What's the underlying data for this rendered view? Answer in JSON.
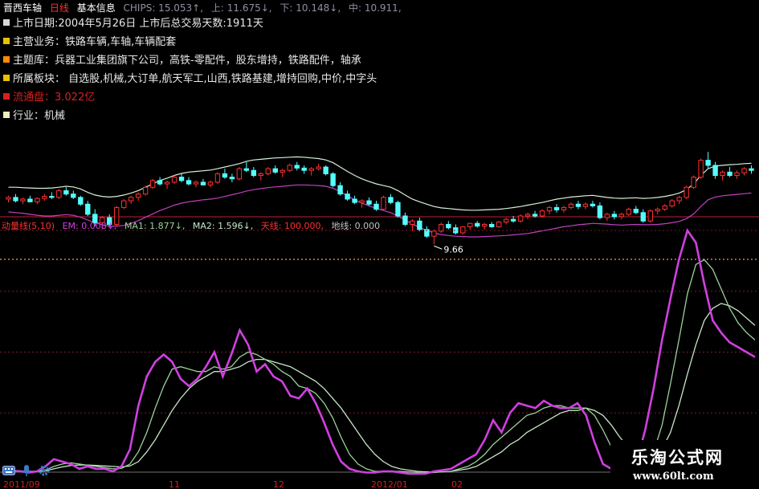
{
  "header": {
    "stock_name": "晋西车轴",
    "period": "日线",
    "info_title": "基本信息",
    "chips": "CHIPS: 15.053↑,",
    "up": "上: 11.675↓,",
    "down": "下: 10.148↓,",
    "mid": "中: 10.911,"
  },
  "info_lines": [
    {
      "text": "上市日期:2004年5月26日  上市后总交易天数:1911天",
      "color": "#e8e8e8",
      "sq": "#d8d8d8"
    },
    {
      "text": "主营业务：铁路车辆,车轴,车辆配套",
      "color": "#e8e8e8",
      "sq": "#e6c200"
    },
    {
      "text": "主题库：兵器工业集团旗下公司，高铁-零配件，股东增持，铁路配件，轴承",
      "color": "#e8e8e8",
      "sq": "#ff8c00"
    },
    {
      "text": "所属板块：  自选股,机械,大订单,航天军工,山西,铁路基建,增持回购,中价,中字头",
      "color": "#e8e8e8",
      "sq": "#e6c200"
    },
    {
      "text": "流通盘：3.022亿",
      "color": "#d82020",
      "sq": "#d82020"
    },
    {
      "text": "行业：机械",
      "color": "#e8e8e8",
      "sq": "#f0f0c0"
    }
  ],
  "indicator_header": {
    "name": "动量线(5,10)",
    "em": "EM: 0.008↓,",
    "ma1": "MA1: 1.877↓,",
    "ma2": "MA2: 1.596↓,",
    "tj": "天线: 100.000,",
    "dj": "地线: 0.000"
  },
  "low_marker": "9.66",
  "watermark": {
    "title": "乐淘公式网",
    "url": "www.60lt.com"
  },
  "date_labels": [
    "2011/09",
    "11",
    "12",
    "2012/01",
    "02"
  ],
  "toolbar_icons": [
    "keyboard-icon",
    "microphone-icon",
    "gear-icon"
  ],
  "colors": {
    "up": "#ff3030",
    "down": "#54ffff",
    "band_upper": "#d8f0d8",
    "band_lower": "#c040c0",
    "em": "#d040e0",
    "ma1": "#9bd39b",
    "ma2": "#c8e6c8",
    "grid": "#7a1a2a"
  },
  "chart_data": [
    {
      "type": "candlestick",
      "title": "晋西车轴 日线",
      "ylim": [
        9.0,
        13.5
      ],
      "low_label": 9.66,
      "candles": [
        [
          11.0,
          11.1,
          10.9,
          11.05
        ],
        [
          11.05,
          11.15,
          10.9,
          10.95
        ],
        [
          10.95,
          11.05,
          10.85,
          11.0
        ],
        [
          11.0,
          11.1,
          10.9,
          10.92
        ],
        [
          10.92,
          11.05,
          10.85,
          11.02
        ],
        [
          11.02,
          11.15,
          10.95,
          11.08
        ],
        [
          11.08,
          11.2,
          11.0,
          11.05
        ],
        [
          11.05,
          11.3,
          11.0,
          11.25
        ],
        [
          11.25,
          11.35,
          11.1,
          11.15
        ],
        [
          11.15,
          11.25,
          11.0,
          11.05
        ],
        [
          11.05,
          11.1,
          10.8,
          10.85
        ],
        [
          10.85,
          10.95,
          10.5,
          10.55
        ],
        [
          10.55,
          10.7,
          10.2,
          10.3
        ],
        [
          10.3,
          10.5,
          10.1,
          10.45
        ],
        [
          10.45,
          10.55,
          10.2,
          10.25
        ],
        [
          10.25,
          10.8,
          10.2,
          10.75
        ],
        [
          10.75,
          11.0,
          10.7,
          10.95
        ],
        [
          10.95,
          11.1,
          10.85,
          11.05
        ],
        [
          11.05,
          11.2,
          10.95,
          11.15
        ],
        [
          11.15,
          11.4,
          11.1,
          11.35
        ],
        [
          11.35,
          11.6,
          11.3,
          11.55
        ],
        [
          11.55,
          11.65,
          11.4,
          11.45
        ],
        [
          11.45,
          11.55,
          11.3,
          11.5
        ],
        [
          11.5,
          11.7,
          11.45,
          11.65
        ],
        [
          11.65,
          11.75,
          11.5,
          11.55
        ],
        [
          11.55,
          11.65,
          11.4,
          11.45
        ],
        [
          11.45,
          11.55,
          11.35,
          11.5
        ],
        [
          11.5,
          11.6,
          11.4,
          11.42
        ],
        [
          11.42,
          11.55,
          11.35,
          11.5
        ],
        [
          11.5,
          11.8,
          11.45,
          11.75
        ],
        [
          11.75,
          11.9,
          11.6,
          11.65
        ],
        [
          11.65,
          11.75,
          11.5,
          11.6
        ],
        [
          11.6,
          11.95,
          11.55,
          11.9
        ],
        [
          11.9,
          12.1,
          11.8,
          11.85
        ],
        [
          11.85,
          11.95,
          11.65,
          11.7
        ],
        [
          11.7,
          11.8,
          11.55,
          11.75
        ],
        [
          11.75,
          11.95,
          11.7,
          11.9
        ],
        [
          11.9,
          12.0,
          11.75,
          11.8
        ],
        [
          11.8,
          11.9,
          11.65,
          11.85
        ],
        [
          11.85,
          12.05,
          11.8,
          12.0
        ],
        [
          12.0,
          12.1,
          11.85,
          11.92
        ],
        [
          11.92,
          12.0,
          11.75,
          11.85
        ],
        [
          11.85,
          11.95,
          11.7,
          11.9
        ],
        [
          11.9,
          12.05,
          11.85,
          11.95
        ],
        [
          11.95,
          12.0,
          11.7,
          11.75
        ],
        [
          11.75,
          11.8,
          11.35,
          11.4
        ],
        [
          11.4,
          11.5,
          11.1,
          11.15
        ],
        [
          11.15,
          11.25,
          10.95,
          11.0
        ],
        [
          11.0,
          11.1,
          10.85,
          10.9
        ],
        [
          10.9,
          11.0,
          10.75,
          10.95
        ],
        [
          10.95,
          11.05,
          10.8,
          10.85
        ],
        [
          10.85,
          10.95,
          10.65,
          10.7
        ],
        [
          10.7,
          11.1,
          10.65,
          11.05
        ],
        [
          11.05,
          11.15,
          10.85,
          10.9
        ],
        [
          10.9,
          10.95,
          10.45,
          10.5
        ],
        [
          10.5,
          10.6,
          10.2,
          10.25
        ],
        [
          10.25,
          10.4,
          10.05,
          10.35
        ],
        [
          10.35,
          10.45,
          10.05,
          10.1
        ],
        [
          10.1,
          10.2,
          9.85,
          9.9
        ],
        [
          9.9,
          10.1,
          9.66,
          10.05
        ],
        [
          10.05,
          10.3,
          10.0,
          10.25
        ],
        [
          10.25,
          10.35,
          10.1,
          10.15
        ],
        [
          10.15,
          10.25,
          9.95,
          10.0
        ],
        [
          10.0,
          10.2,
          9.95,
          10.18
        ],
        [
          10.18,
          10.3,
          10.1,
          10.28
        ],
        [
          10.28,
          10.35,
          10.15,
          10.2
        ],
        [
          10.2,
          10.3,
          10.1,
          10.25
        ],
        [
          10.25,
          10.32,
          10.15,
          10.18
        ],
        [
          10.18,
          10.35,
          10.15,
          10.32
        ],
        [
          10.32,
          10.45,
          10.25,
          10.4
        ],
        [
          10.4,
          10.5,
          10.3,
          10.35
        ],
        [
          10.35,
          10.55,
          10.3,
          10.5
        ],
        [
          10.5,
          10.6,
          10.4,
          10.55
        ],
        [
          10.55,
          10.65,
          10.45,
          10.5
        ],
        [
          10.5,
          10.7,
          10.45,
          10.65
        ],
        [
          10.65,
          10.8,
          10.55,
          10.75
        ],
        [
          10.75,
          10.85,
          10.6,
          10.68
        ],
        [
          10.68,
          10.8,
          10.6,
          10.75
        ],
        [
          10.75,
          10.9,
          10.7,
          10.85
        ],
        [
          10.85,
          10.95,
          10.7,
          10.78
        ],
        [
          10.78,
          10.9,
          10.7,
          10.85
        ],
        [
          10.85,
          10.95,
          10.75,
          10.8
        ],
        [
          10.8,
          10.9,
          10.4,
          10.45
        ],
        [
          10.45,
          10.6,
          10.35,
          10.55
        ],
        [
          10.55,
          10.65,
          10.4,
          10.48
        ],
        [
          10.48,
          10.6,
          10.4,
          10.55
        ],
        [
          10.55,
          10.75,
          10.5,
          10.7
        ],
        [
          10.7,
          10.8,
          10.55,
          10.6
        ],
        [
          10.6,
          10.7,
          10.3,
          10.35
        ],
        [
          10.35,
          10.7,
          10.3,
          10.65
        ],
        [
          10.65,
          10.75,
          10.55,
          10.7
        ],
        [
          10.7,
          10.85,
          10.65,
          10.8
        ],
        [
          10.8,
          11.0,
          10.75,
          10.95
        ],
        [
          10.95,
          11.1,
          10.85,
          11.05
        ],
        [
          11.05,
          11.4,
          11.0,
          11.35
        ],
        [
          11.35,
          11.7,
          11.3,
          11.65
        ],
        [
          11.65,
          12.2,
          11.6,
          12.15
        ],
        [
          12.15,
          12.4,
          11.9,
          12.0
        ],
        [
          12.0,
          12.1,
          11.6,
          11.7
        ],
        [
          11.7,
          11.85,
          11.55,
          11.8
        ],
        [
          11.8,
          11.95,
          11.65,
          11.7
        ],
        [
          11.7,
          11.85,
          11.6,
          11.78
        ],
        [
          11.78,
          11.95,
          11.7,
          11.9
        ],
        [
          11.9,
          12.0,
          11.75,
          11.85
        ]
      ],
      "band_upper": [
        11.35,
        11.35,
        11.34,
        11.33,
        11.32,
        11.32,
        11.33,
        11.35,
        11.38,
        11.36,
        11.3,
        11.2,
        11.12,
        11.08,
        11.06,
        11.08,
        11.12,
        11.18,
        11.25,
        11.35,
        11.45,
        11.55,
        11.62,
        11.7,
        11.76,
        11.8,
        11.82,
        11.84,
        11.86,
        11.9,
        11.95,
        12.0,
        12.05,
        12.12,
        12.16,
        12.18,
        12.2,
        12.22,
        12.23,
        12.24,
        12.25,
        12.24,
        12.22,
        12.2,
        12.16,
        12.08,
        11.95,
        11.82,
        11.7,
        11.6,
        11.52,
        11.45,
        11.4,
        11.35,
        11.25,
        11.12,
        11.0,
        10.92,
        10.85,
        10.78,
        10.74,
        10.72,
        10.7,
        10.68,
        10.67,
        10.67,
        10.68,
        10.69,
        10.7,
        10.72,
        10.75,
        10.78,
        10.82,
        10.86,
        10.9,
        10.95,
        11.0,
        11.03,
        11.06,
        11.08,
        11.1,
        11.11,
        11.08,
        11.05,
        11.03,
        11.02,
        11.03,
        11.04,
        11.02,
        11.03,
        11.05,
        11.08,
        11.12,
        11.18,
        11.28,
        11.45,
        11.7,
        11.9,
        11.98,
        12.0,
        12.02,
        12.03,
        12.05,
        12.06
      ],
      "band_lower": [
        10.62,
        10.6,
        10.58,
        10.55,
        10.52,
        10.5,
        10.5,
        10.52,
        10.54,
        10.52,
        10.46,
        10.38,
        10.3,
        10.24,
        10.2,
        10.2,
        10.22,
        10.28,
        10.36,
        10.46,
        10.56,
        10.66,
        10.74,
        10.82,
        10.88,
        10.92,
        10.95,
        10.98,
        11.0,
        11.03,
        11.08,
        11.13,
        11.18,
        11.24,
        11.28,
        11.31,
        11.34,
        11.36,
        11.38,
        11.4,
        11.42,
        11.42,
        11.41,
        11.4,
        11.38,
        11.32,
        11.22,
        11.1,
        10.98,
        10.88,
        10.8,
        10.72,
        10.66,
        10.6,
        10.5,
        10.38,
        10.26,
        10.16,
        10.07,
        10.0,
        9.95,
        9.92,
        9.9,
        9.89,
        9.88,
        9.88,
        9.89,
        9.9,
        9.91,
        9.92,
        9.94,
        9.96,
        9.98,
        10.02,
        10.06,
        10.1,
        10.14,
        10.18,
        10.21,
        10.24,
        10.26,
        10.28,
        10.27,
        10.26,
        10.24,
        10.23,
        10.24,
        10.25,
        10.24,
        10.24,
        10.25,
        10.27,
        10.3,
        10.34,
        10.42,
        10.56,
        10.78,
        10.98,
        11.06,
        11.1,
        11.12,
        11.14,
        11.16,
        11.18
      ]
    },
    {
      "type": "line",
      "title": "动量线(5,10)",
      "ylim": [
        0,
        100
      ],
      "reference_lines": [
        100,
        0
      ],
      "series": [
        {
          "name": "EM",
          "color": "#d040e0",
          "values": [
            2,
            1,
            1,
            0.5,
            1,
            3,
            6,
            5,
            4,
            2,
            3,
            2,
            2,
            1,
            3,
            10,
            28,
            40,
            46,
            49,
            46,
            39,
            36,
            39,
            44,
            50,
            40,
            49,
            59,
            53,
            42,
            45,
            40,
            38,
            32,
            31,
            35,
            29,
            21,
            12,
            5,
            2,
            1,
            0.5,
            0.5,
            1,
            1,
            0.5,
            0,
            0,
            0,
            1,
            1.5,
            2,
            4,
            6,
            8,
            14,
            22,
            17,
            25,
            29,
            28,
            27,
            30,
            28,
            27,
            27,
            29,
            24,
            13,
            4,
            2,
            0.5,
            0.2,
            5,
            18,
            35,
            55,
            72,
            88,
            100,
            95,
            78,
            63,
            58,
            54,
            52,
            50,
            48
          ]
        },
        {
          "name": "MA1",
          "color": "#9bd39b",
          "values": [
            1.5,
            1.4,
            1.2,
            1,
            1,
            1.5,
            3,
            4,
            4.5,
            4,
            3.5,
            3,
            2.5,
            2,
            2.2,
            4,
            9,
            17,
            27,
            36,
            43,
            44,
            43,
            42,
            42,
            44,
            43,
            44,
            48,
            50,
            49,
            47,
            45,
            42,
            40,
            36,
            35,
            33,
            29,
            23,
            15,
            8,
            4,
            2,
            1,
            1,
            1,
            1,
            0.8,
            0.5,
            0.3,
            0.5,
            0.8,
            1,
            2,
            3,
            5,
            8,
            12,
            15,
            18,
            21,
            24,
            25,
            27,
            28,
            28,
            27,
            27,
            27,
            24,
            18,
            11,
            5,
            2,
            1,
            3,
            9,
            20,
            37,
            55,
            74,
            86,
            88,
            84,
            76,
            68,
            62,
            58,
            55
          ]
        },
        {
          "name": "MA2",
          "color": "#c8e6c8",
          "values": [
            1.2,
            1.2,
            1.1,
            1,
            1,
            1.2,
            2,
            2.8,
            3.4,
            3.6,
            3.6,
            3.4,
            3.2,
            3,
            2.8,
            3.2,
            5,
            9,
            14,
            20,
            26,
            31,
            35,
            38,
            40,
            42,
            42,
            43,
            44,
            46,
            47,
            47,
            46,
            45,
            44,
            42,
            40,
            38,
            35,
            31,
            27,
            22,
            17,
            12,
            8,
            5,
            3,
            2,
            1.5,
            1,
            0.8,
            0.8,
            0.8,
            1,
            1.5,
            2,
            3,
            5,
            7,
            9,
            12,
            14,
            17,
            19,
            21,
            23,
            25,
            26,
            26,
            27,
            26,
            24,
            20,
            15,
            11,
            7,
            5,
            6,
            10,
            17,
            28,
            41,
            53,
            63,
            68,
            70,
            69,
            67,
            64,
            61
          ]
        }
      ]
    }
  ]
}
